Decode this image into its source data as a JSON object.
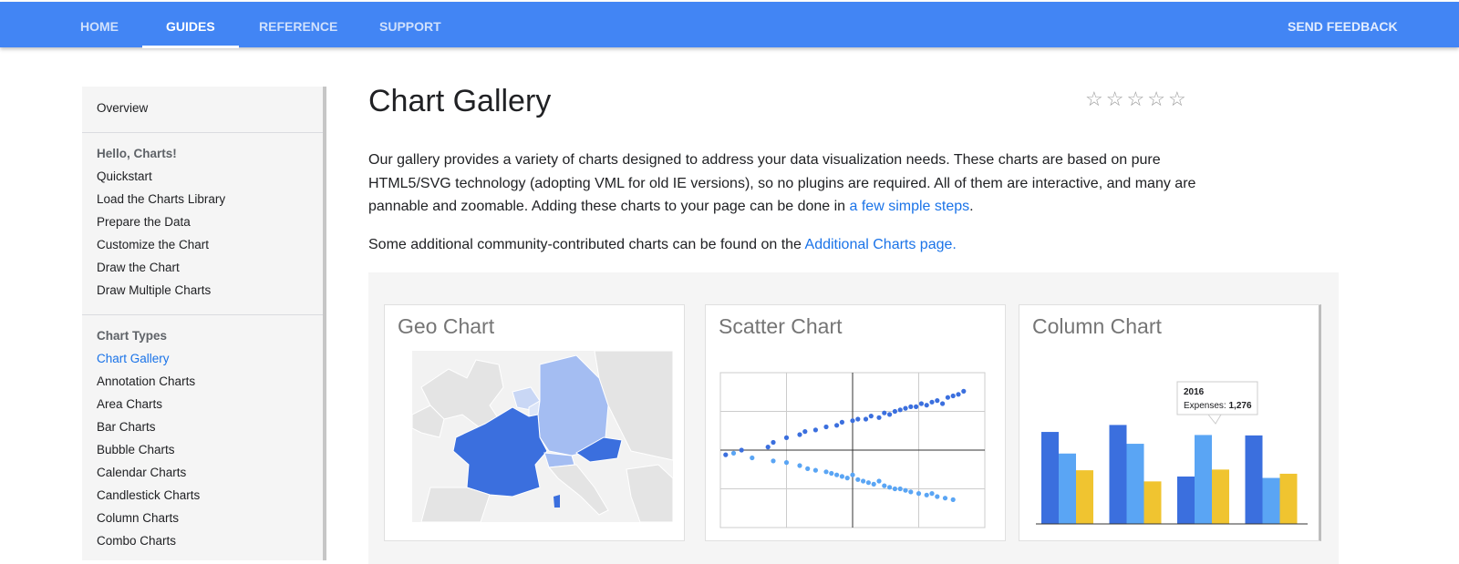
{
  "nav": {
    "tabs": [
      {
        "label": "HOME"
      },
      {
        "label": "GUIDES",
        "active": true
      },
      {
        "label": "REFERENCE"
      },
      {
        "label": "SUPPORT"
      }
    ],
    "feedback_label": "SEND FEEDBACK",
    "bar_color": "#4285f4"
  },
  "sidebar": {
    "overview": "Overview",
    "section1_title": "Hello, Charts!",
    "section1_items": [
      "Quickstart",
      "Load the Charts Library",
      "Prepare the Data",
      "Customize the Chart",
      "Draw the Chart",
      "Draw Multiple Charts"
    ],
    "section2_title": "Chart Types",
    "section2_items": [
      "Chart Gallery",
      "Annotation Charts",
      "Area Charts",
      "Bar Charts",
      "Bubble Charts",
      "Calendar Charts",
      "Candlestick Charts",
      "Column Charts",
      "Combo Charts"
    ],
    "active_item": "Chart Gallery"
  },
  "main": {
    "title": "Chart Gallery",
    "rating": {
      "stars": 5,
      "filled": 0,
      "icon": "star-outline-icon"
    },
    "intro_text": "Our gallery provides a variety of charts designed to address your data visualization needs. These charts are based on pure HTML5/SVG technology (adopting VML for old IE versions), so no plugins are required. All of them are interactive, and many are pannable and zoomable. Adding these charts to your page can be done in ",
    "intro_link": "a few simple steps",
    "intro_end": ".",
    "community_text": "Some additional community-contributed charts can be found on the ",
    "community_link": "Additional Charts page."
  },
  "gallery": {
    "cards": [
      {
        "title": "Geo Chart"
      },
      {
        "title": "Scatter Chart"
      },
      {
        "title": "Column Chart"
      }
    ],
    "tooltip_year": "2016",
    "tooltip_label": "Expenses: ",
    "tooltip_value": "1,276",
    "colors": {
      "dark_blue": "#3b6fde",
      "light_blue": "#5aa5f4",
      "yellow": "#f0c430",
      "geo_light": "#a4bdf2"
    }
  },
  "chart_data": [
    {
      "type": "scatter",
      "title": "Scatter Chart",
      "series": [
        {
          "name": "",
          "color": "#3b6fde",
          "x": [
            2,
            8,
            18,
            20,
            25,
            30,
            32,
            36,
            40,
            44,
            46,
            50,
            52,
            55,
            57,
            60,
            62,
            64,
            66,
            68,
            70,
            72,
            74,
            76,
            78,
            80,
            82,
            84,
            86,
            88,
            90,
            92
          ],
          "y": [
            47,
            50,
            52,
            55,
            58,
            60,
            62,
            63,
            65,
            66,
            68,
            69,
            70,
            70,
            72,
            71,
            74,
            73,
            75,
            76,
            77,
            78,
            78,
            80,
            79,
            81,
            82,
            80,
            84,
            85,
            86,
            88
          ]
        },
        {
          "name": "",
          "color": "#5aa5f4",
          "x": [
            5,
            12,
            20,
            25,
            30,
            33,
            36,
            40,
            42,
            44,
            46,
            48,
            50,
            52,
            54,
            56,
            58,
            60,
            62,
            64,
            66,
            68,
            70,
            72,
            75,
            78,
            80,
            82,
            85,
            88
          ],
          "y": [
            48,
            45,
            43,
            42,
            40,
            38,
            37,
            36,
            35,
            34,
            33,
            32,
            34,
            31,
            30,
            29,
            28,
            30,
            27,
            26,
            25,
            25,
            24,
            23,
            22,
            21,
            22,
            20,
            19,
            18
          ]
        }
      ]
    },
    {
      "type": "bar",
      "title": "Column Chart",
      "categories": [
        "",
        "",
        "",
        ""
      ],
      "series": [
        {
          "name": "",
          "color": "#3b6fde",
          "values": [
            1320,
            1420,
            680,
            1270
          ]
        },
        {
          "name": "",
          "color": "#5aa5f4",
          "values": [
            1010,
            1150,
            1276,
            660
          ]
        },
        {
          "name": "Expenses",
          "color": "#f0c430",
          "values": [
            770,
            610,
            780,
            720
          ]
        }
      ],
      "ylim": [
        0,
        1700
      ]
    }
  ]
}
